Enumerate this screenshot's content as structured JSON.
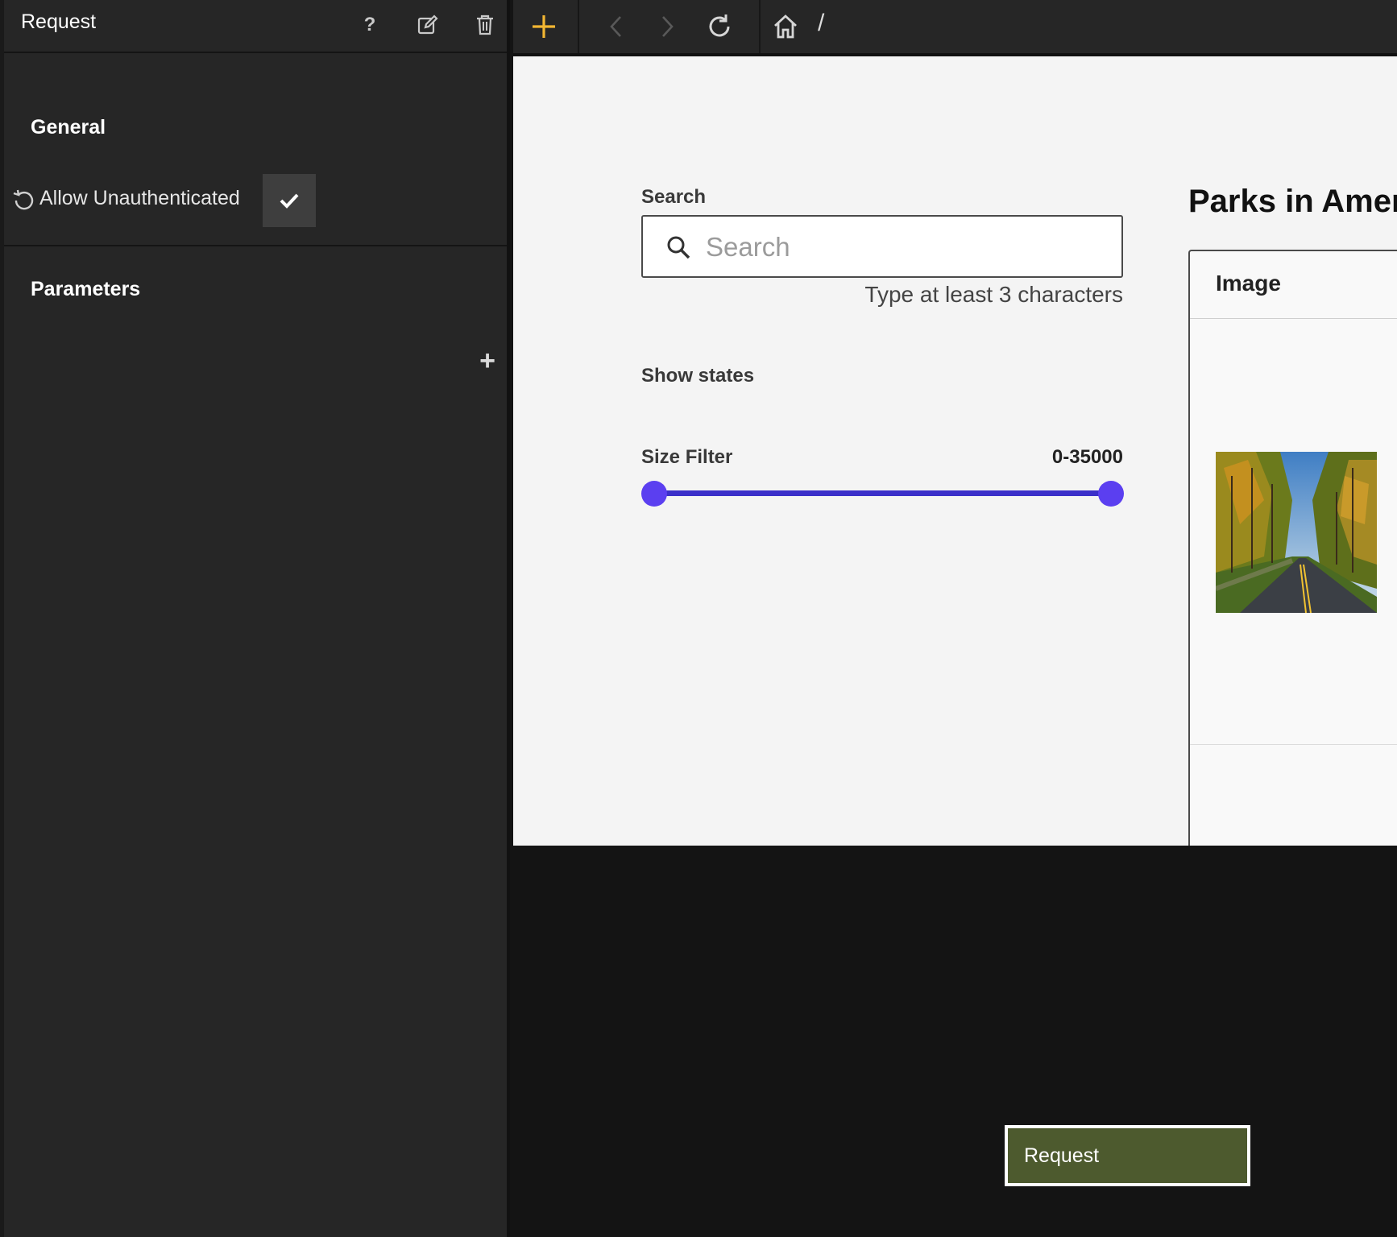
{
  "panel": {
    "title": "Request",
    "help_icon": "help-icon",
    "edit_icon": "edit-icon",
    "delete_icon": "trash-icon",
    "general_heading": "General",
    "allow_unauth_label": "Allow Unauthenticated",
    "allow_unauth_checked": true,
    "parameters_heading": "Parameters"
  },
  "toolbar": {
    "add_icon": "plus-icon",
    "back_icon": "chevron-left-icon",
    "forward_icon": "chevron-right-icon",
    "reload_icon": "reload-icon",
    "home_icon": "home-icon",
    "path": "/",
    "accent": "#f2b632"
  },
  "app": {
    "search_label": "Search",
    "search_placeholder": "Search",
    "search_hint": "Type at least 3 characters",
    "show_states_label": "Show states",
    "size_filter_label": "Size Filter",
    "size_filter_value": "0-35000",
    "size_filter_range": [
      0,
      35000
    ],
    "slider_color": "#5b3ff0",
    "results_title": "Parks in Ameri",
    "table_columns": [
      "Image"
    ]
  },
  "footer": {
    "request_button": "Request"
  }
}
